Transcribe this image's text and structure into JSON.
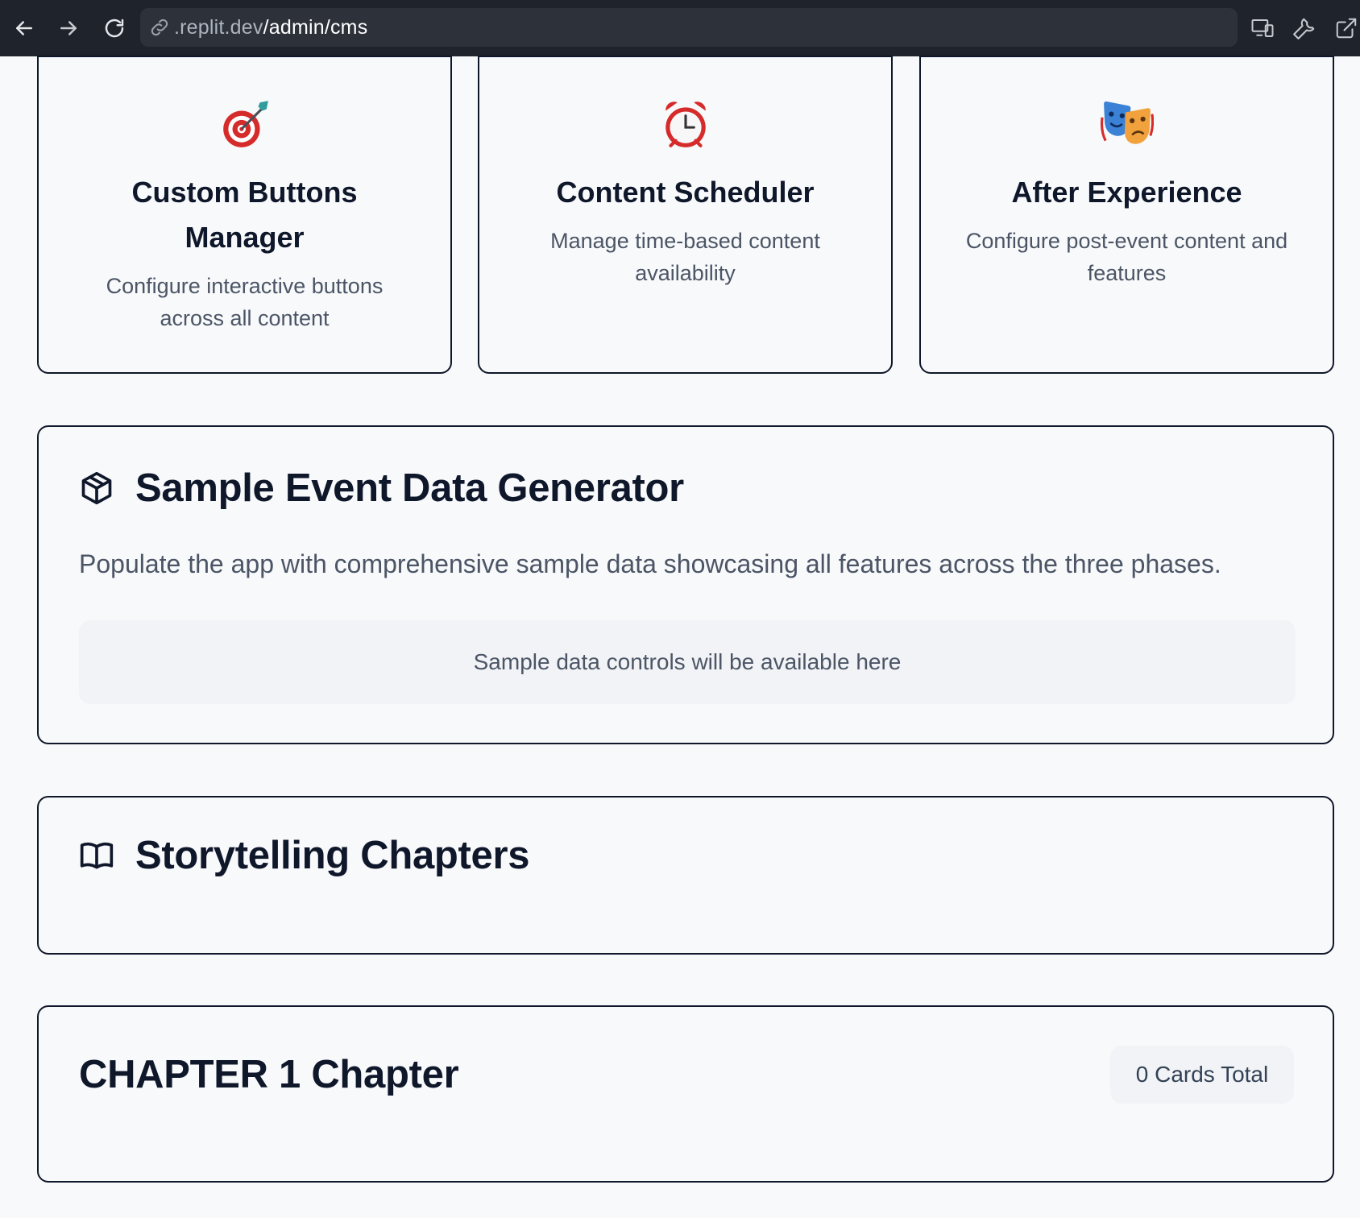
{
  "browser": {
    "url_host": ".replit.dev",
    "url_path": "/admin/cms",
    "icons": [
      "back-arrow-icon",
      "forward-arrow-icon",
      "reload-icon",
      "link-icon",
      "devices-icon",
      "wrench-icon",
      "open-external-icon"
    ]
  },
  "features": [
    {
      "icon": "dart-target-icon",
      "title_line1": "Custom Buttons",
      "title_line2": "Manager",
      "desc_line1": "Configure interactive buttons",
      "desc_line2": "across all content"
    },
    {
      "icon": "alarm-clock-icon",
      "title_line1": "Content Scheduler",
      "desc_line1": "Manage time-based content",
      "desc_line2": "availability"
    },
    {
      "icon": "theater-masks-icon",
      "title_line1": "After Experience",
      "desc_line1": "Configure post-event content and",
      "desc_line2": "features"
    }
  ],
  "sample_generator": {
    "icon": "cube-icon",
    "title": "Sample Event Data Generator",
    "description": "Populate the app with comprehensive sample data showcasing all features across the three phases.",
    "placeholder": "Sample data controls will be available here"
  },
  "storytelling": {
    "icon": "open-book-icon",
    "title": "Storytelling Chapters"
  },
  "chapter": {
    "title": "CHAPTER 1 Chapter",
    "count_label": "0 Cards Total"
  },
  "colors": {
    "topbar": "#1f232b",
    "page_bg": "#f8f9fb",
    "border": "#0f172a",
    "muted_text": "#4b5565"
  }
}
